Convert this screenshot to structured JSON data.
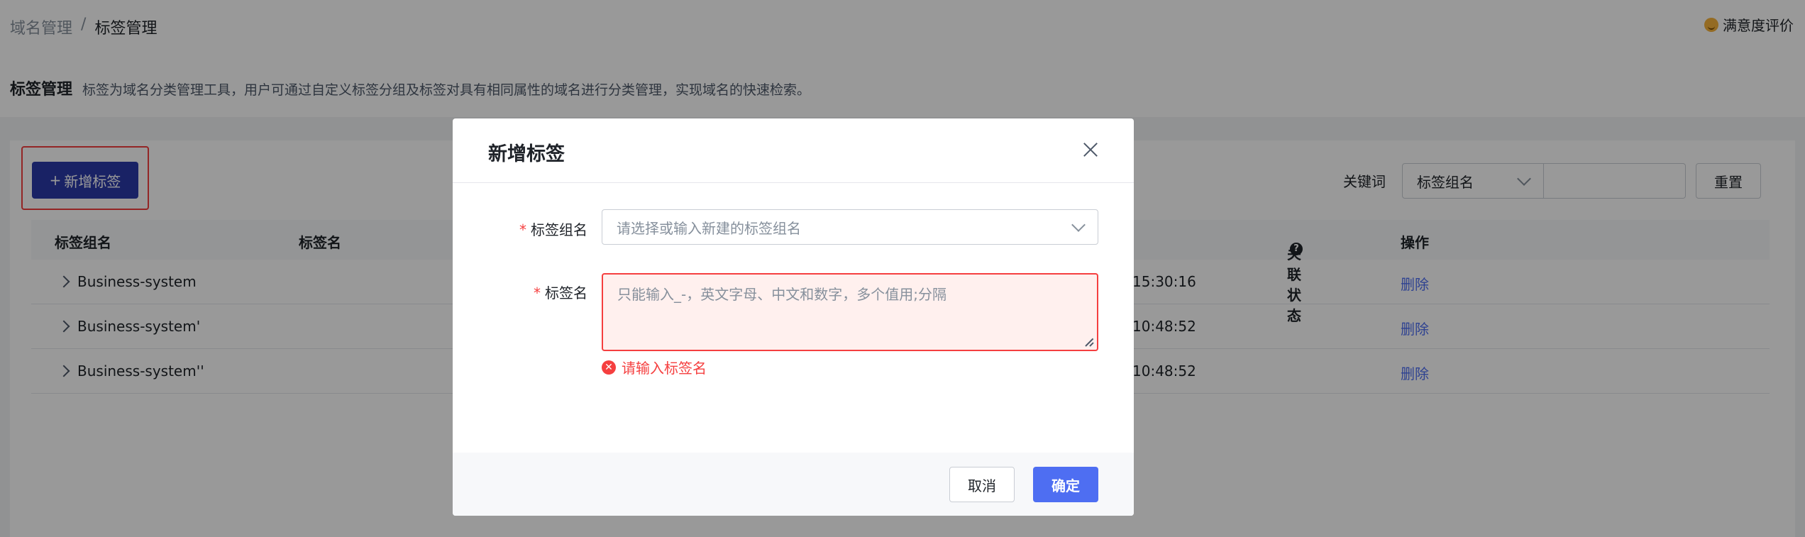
{
  "breadcrumb": {
    "parent": "域名管理",
    "separator": "/",
    "current": "标签管理"
  },
  "satisfaction_label": "满意度评价",
  "page": {
    "title": "标签管理",
    "description": "标签为域名分类管理工具，用户可通过自定义标签分组及标签对具有相同属性的域名进行分类管理，实现域名的快速检索。"
  },
  "toolbar": {
    "add_label": "新增标签",
    "add_icon": "+",
    "keyword_label": "关键词",
    "filter_select_value": "标签组名",
    "reset_label": "重置"
  },
  "table": {
    "headers": {
      "group": "标签组名",
      "name": "标签名",
      "status": "关联状态",
      "action": "操作"
    },
    "rows": [
      {
        "group": "Business-system",
        "time": "15:30:16",
        "action": "删除"
      },
      {
        "group": "Business-system'",
        "time": "10:48:52",
        "action": "删除"
      },
      {
        "group": "Business-system''",
        "time": "10:48:52",
        "action": "删除"
      }
    ]
  },
  "modal": {
    "title": "新增标签",
    "group_field": {
      "required_mark": "*",
      "label": "标签组名",
      "placeholder": "请选择或输入新建的标签组名"
    },
    "name_field": {
      "required_mark": "*",
      "label": "标签名",
      "placeholder": "只能输入_-，英文字母、中文和数字，多个值用;分隔",
      "error": "请输入标签名"
    },
    "cancel_label": "取消",
    "confirm_label": "确定"
  },
  "colors": {
    "primary": "#4e6ef2",
    "error": "#f53f3f",
    "add_button": "#2b3aa8"
  }
}
